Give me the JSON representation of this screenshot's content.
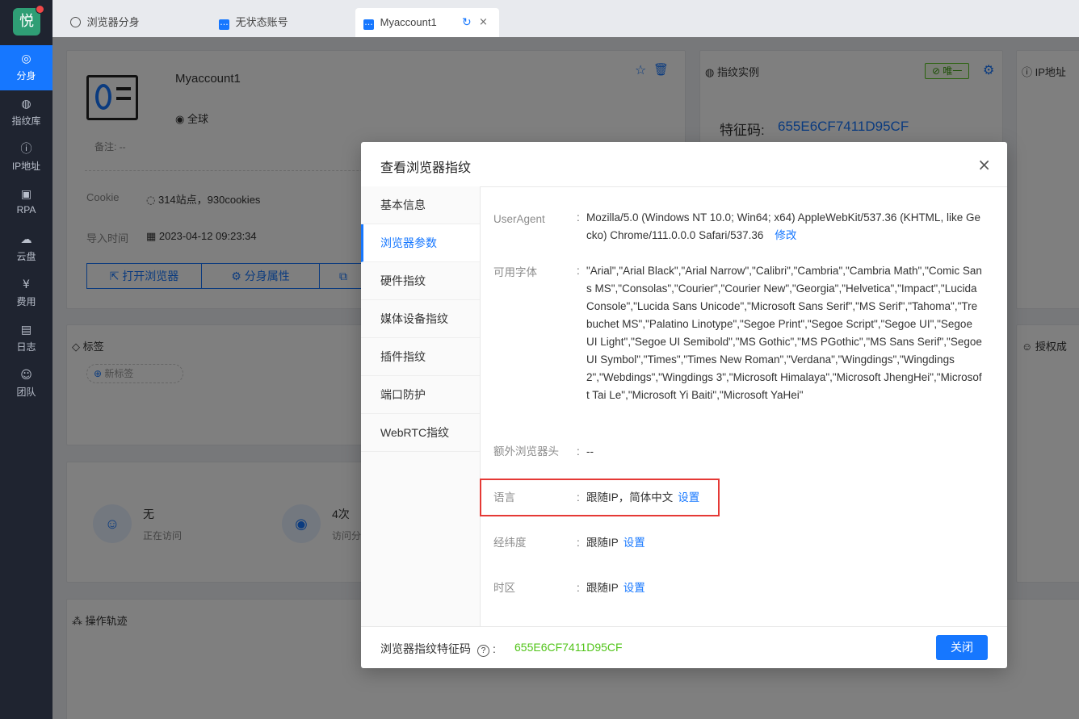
{
  "sidebar": {
    "logo": "悦",
    "items": [
      {
        "label": "分身",
        "icon": "chrome-icon"
      },
      {
        "label": "指纹库",
        "icon": "fingerprint-icon"
      },
      {
        "label": "IP地址",
        "icon": "ip-icon"
      },
      {
        "label": "RPA",
        "icon": "robot-icon"
      },
      {
        "label": "云盘",
        "icon": "cloud-icon"
      },
      {
        "label": "费用",
        "icon": "yen-icon"
      },
      {
        "label": "日志",
        "icon": "document-icon"
      },
      {
        "label": "团队",
        "icon": "team-icon"
      }
    ]
  },
  "tabs": [
    {
      "label": "浏览器分身"
    },
    {
      "label": "无状态账号"
    },
    {
      "label": "Myaccount1"
    }
  ],
  "profile": {
    "name": "Myaccount1",
    "region": "全球",
    "note": "备注: --",
    "cookie_label": "Cookie",
    "cookie_value": "314站点，930cookies",
    "import_label": "导入时间",
    "import_value": "2023-04-12 09:23:34",
    "open_browser": "打开浏览器",
    "properties": "分身属性"
  },
  "fingerprint_card": {
    "title": "指纹实例",
    "badge": "唯一",
    "code_label": "特征码:",
    "code_value": "655E6CF7411D95CF"
  },
  "ip_card": {
    "title": "IP地址"
  },
  "tags": {
    "title": "标签",
    "add": "新标签"
  },
  "auth": {
    "title": "授权成"
  },
  "stats": {
    "visitor": "无",
    "visitor_label": "正在访问",
    "visits": "4次",
    "visits_label": "访问分"
  },
  "trail": {
    "title": "操作轨迹"
  },
  "modal": {
    "title": "查看浏览器指纹",
    "menu": [
      "基本信息",
      "浏览器参数",
      "硬件指纹",
      "媒体设备指纹",
      "插件指纹",
      "端口防护",
      "WebRTC指纹"
    ],
    "fields": {
      "useragent_label": "UserAgent",
      "useragent_value": "Mozilla/5.0 (Windows NT 10.0; Win64; x64) AppleWebKit/537.36 (KHTML, like Gecko) Chrome/111.0.0.0 Safari/537.36",
      "useragent_action": "修改",
      "fonts_label": "可用字体",
      "fonts_value": "\"Arial\",\"Arial Black\",\"Arial Narrow\",\"Calibri\",\"Cambria\",\"Cambria Math\",\"Comic Sans MS\",\"Consolas\",\"Courier\",\"Courier New\",\"Georgia\",\"Helvetica\",\"Impact\",\"Lucida Console\",\"Lucida Sans Unicode\",\"Microsoft Sans Serif\",\"MS Serif\",\"Tahoma\",\"Trebuchet MS\",\"Palatino Linotype\",\"Segoe Print\",\"Segoe Script\",\"Segoe UI\",\"Segoe UI Light\",\"Segoe UI Semibold\",\"MS Gothic\",\"MS PGothic\",\"MS Sans Serif\",\"Segoe UI Symbol\",\"Times\",\"Times New Roman\",\"Verdana\",\"Wingdings\",\"Wingdings 2\",\"Webdings\",\"Wingdings 3\",\"Microsoft Himalaya\",\"Microsoft JhengHei\",\"Microsoft Tai Le\",\"Microsoft Yi Baiti\",\"Microsoft YaHei\"",
      "extra_label": "额外浏览器头",
      "extra_value": "--",
      "lang_label": "语言",
      "lang_value": "跟随IP，简体中文",
      "lang_action": "设置",
      "geo_label": "经纬度",
      "geo_value": "跟随IP",
      "geo_action": "设置",
      "tz_label": "时区",
      "tz_value": "跟随IP",
      "tz_action": "设置"
    },
    "footer_label": "浏览器指纹特征码",
    "footer_code": "655E6CF7411D95CF",
    "close": "关闭"
  }
}
